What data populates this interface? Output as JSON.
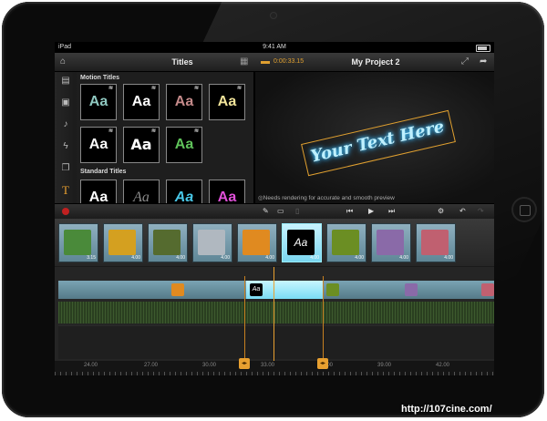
{
  "status_bar": {
    "carrier": "iPad",
    "time": "9:41 AM"
  },
  "header": {
    "panel_title": "Titles",
    "timecode": "0:00:33.15",
    "project_title": "My Project 2"
  },
  "sidebar": {
    "items": [
      {
        "icon": "clapper-icon"
      },
      {
        "icon": "photo-icon"
      },
      {
        "icon": "music-note-icon"
      },
      {
        "icon": "lightning-icon"
      },
      {
        "icon": "stack-icon"
      },
      {
        "icon": "text-T-icon",
        "label": "T"
      }
    ]
  },
  "titles_panel": {
    "motion_label": "Motion Titles",
    "standard_label": "Standard Titles",
    "motion_tiles": [
      {
        "text": "Aa",
        "color": "#8fc8c0"
      },
      {
        "text": "Aa",
        "color": "#ffffff"
      },
      {
        "text": "Aa",
        "color": "#c48a8a"
      },
      {
        "text": "Aa",
        "color": "#f2e49a"
      },
      {
        "text": "Aa",
        "color": "#ffffff"
      },
      {
        "text": "Aa",
        "color": "#ffffff"
      },
      {
        "text": "Aa",
        "color": "#5fc25a"
      }
    ],
    "standard_tiles": [
      {
        "text": "Aa",
        "color": "#ffffff"
      },
      {
        "text": "Aa",
        "color": "#8a8a8a"
      },
      {
        "text": "Aa",
        "color": "#49c8e8"
      },
      {
        "text": "Aa",
        "color": "#e050d8"
      }
    ]
  },
  "preview": {
    "title_text": "Your Text Here",
    "render_note": "Needs rendering for accurate and smooth preview"
  },
  "storyboard": {
    "clips": [
      {
        "duration": "3.15",
        "color": "#4a8a3a"
      },
      {
        "duration": "4.00",
        "color": "#d4a020"
      },
      {
        "duration": "4.00",
        "color": "#556b2f"
      },
      {
        "duration": "4.00",
        "color": "#b0b8c0"
      },
      {
        "duration": "4.00",
        "color": "#e08a20"
      },
      {
        "duration": "4.00",
        "text": "Aa",
        "selected": true
      },
      {
        "duration": "4.00",
        "color": "#6b8e23"
      },
      {
        "duration": "4.00",
        "color": "#8a6aa8"
      },
      {
        "duration": "4.00",
        "color": "#c06070"
      }
    ]
  },
  "timeline": {
    "ruler_labels": [
      "24.00",
      "27.00",
      "30.00",
      "33.00",
      "36.00",
      "39.00",
      "42.00"
    ],
    "track_title": "Aa"
  },
  "watermark": "http://107cine.com/"
}
